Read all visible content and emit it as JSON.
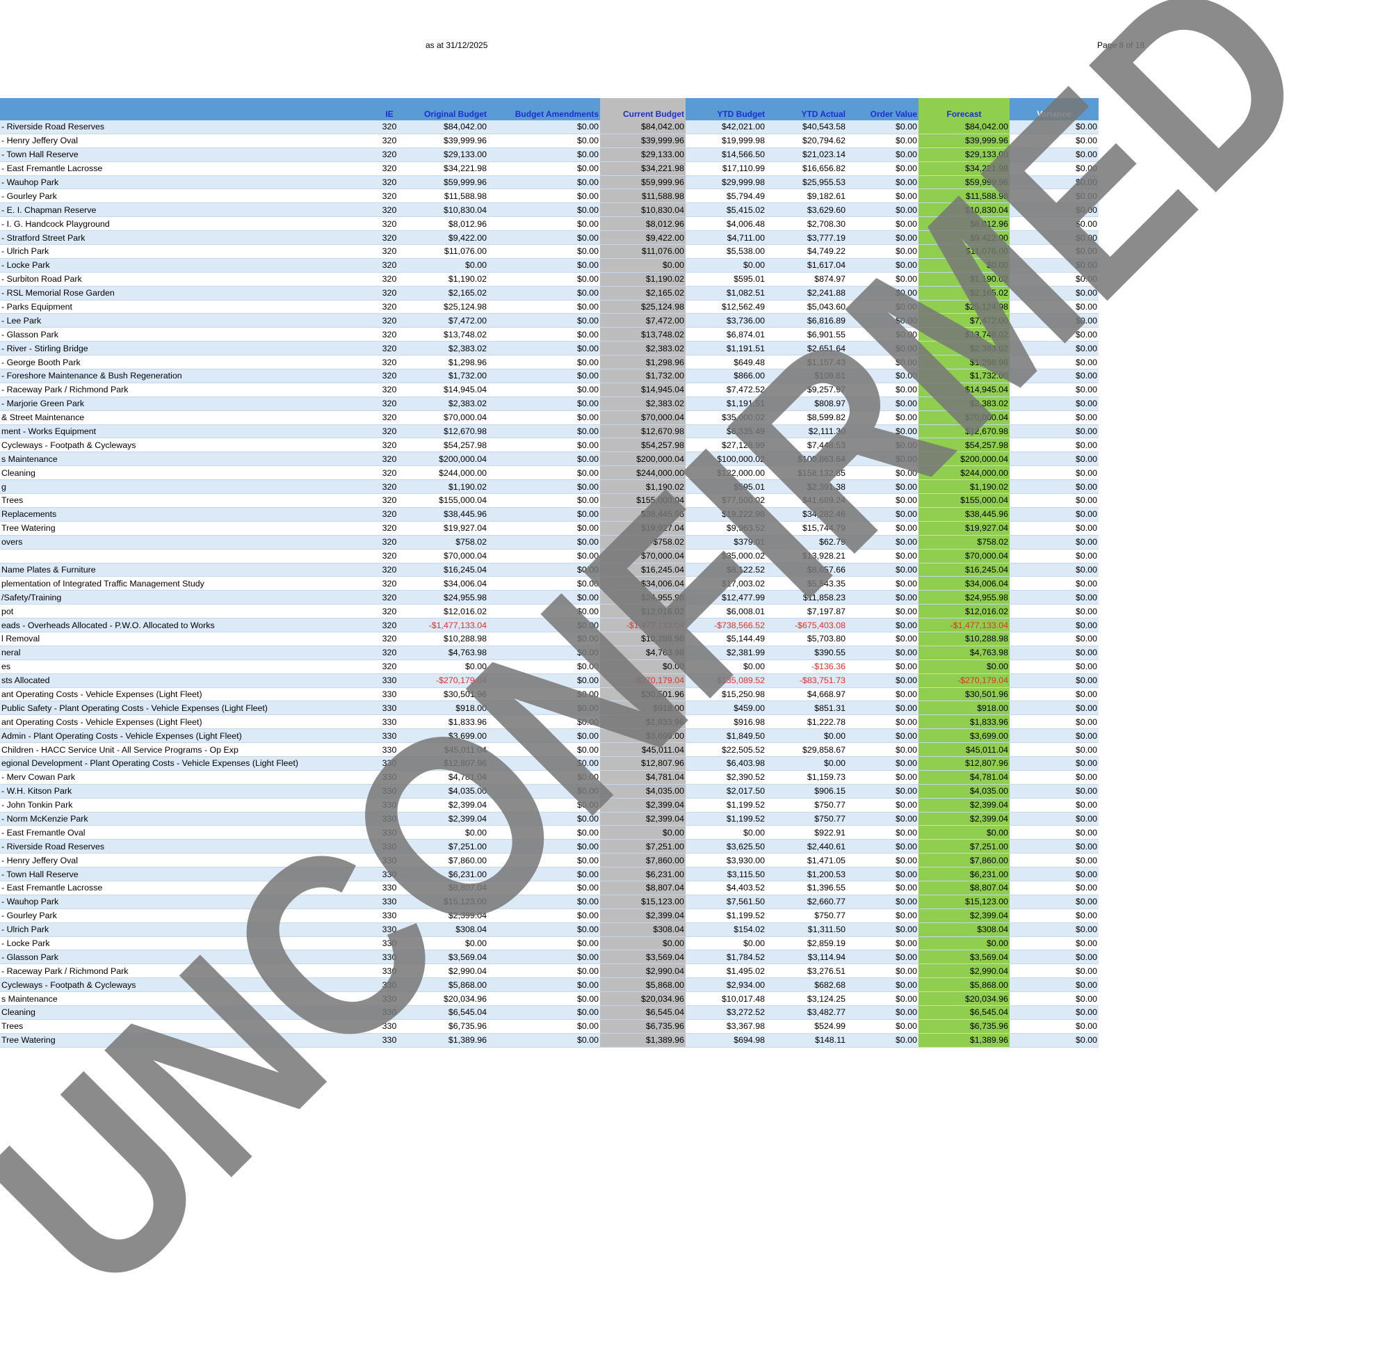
{
  "header": {
    "date_text": "as at 31/12/2025",
    "page_text": "Page 8 of 18"
  },
  "columns": [
    "",
    "IE",
    "Original Budget",
    "Budget Amendments",
    "Current Budget",
    "YTD Budget",
    "YTD Actual",
    "Order Value",
    "Forecast",
    "Variance"
  ],
  "rows": [
    [
      "- Riverside Road Reserves",
      "320",
      "$84,042.00",
      "$0.00",
      "$84,042.00",
      "$42,021.00",
      "$40,543.58",
      "$0.00",
      "$84,042.00",
      "$0.00"
    ],
    [
      "- Henry Jeffery Oval",
      "320",
      "$39,999.96",
      "$0.00",
      "$39,999.96",
      "$19,999.98",
      "$20,794.62",
      "$0.00",
      "$39,999.96",
      "$0.00"
    ],
    [
      "- Town Hall Reserve",
      "320",
      "$29,133.00",
      "$0.00",
      "$29,133.00",
      "$14,566.50",
      "$21,023.14",
      "$0.00",
      "$29,133.00",
      "$0.00"
    ],
    [
      "-  East Fremantle Lacrosse",
      "320",
      "$34,221.98",
      "$0.00",
      "$34,221.98",
      "$17,110.99",
      "$16,656.82",
      "$0.00",
      "$34,221.98",
      "$0.00"
    ],
    [
      "- Wauhop Park",
      "320",
      "$59,999.96",
      "$0.00",
      "$59,999.96",
      "$29,999.98",
      "$25,955.53",
      "$0.00",
      "$59,999.96",
      "$0.00"
    ],
    [
      "- Gourley Park",
      "320",
      "$11,588.98",
      "$0.00",
      "$11,588.98",
      "$5,794.49",
      "$9,182.61",
      "$0.00",
      "$11,588.98",
      "$0.00"
    ],
    [
      "- E. I. Chapman Reserve",
      "320",
      "$10,830.04",
      "$0.00",
      "$10,830.04",
      "$5,415.02",
      "$3,629.60",
      "$0.00",
      "$10,830.04",
      "$0.00"
    ],
    [
      "- I. G. Handcock Playground",
      "320",
      "$8,012.96",
      "$0.00",
      "$8,012.96",
      "$4,006.48",
      "$2,708.30",
      "$0.00",
      "$8,012.96",
      "$0.00"
    ],
    [
      "- Stratford Street Park",
      "320",
      "$9,422.00",
      "$0.00",
      "$9,422.00",
      "$4,711.00",
      "$3,777.19",
      "$0.00",
      "$9,422.00",
      "$0.00"
    ],
    [
      "- Ulrich Park",
      "320",
      "$11,076.00",
      "$0.00",
      "$11,076.00",
      "$5,538.00",
      "$4,749.22",
      "$0.00",
      "$11,076.00",
      "$0.00"
    ],
    [
      "- Locke Park",
      "320",
      "$0.00",
      "$0.00",
      "$0.00",
      "$0.00",
      "$1,617.04",
      "$0.00",
      "$0.00",
      "$0.00"
    ],
    [
      "- Surbiton Road Park",
      "320",
      "$1,190.02",
      "$0.00",
      "$1,190.02",
      "$595.01",
      "$874.97",
      "$0.00",
      "$1,190.02",
      "$0.00"
    ],
    [
      "- RSL Memorial Rose Garden",
      "320",
      "$2,165.02",
      "$0.00",
      "$2,165.02",
      "$1,082.51",
      "$2,241.88",
      "$0.00",
      "$2,165.02",
      "$0.00"
    ],
    [
      "- Parks Equipment",
      "320",
      "$25,124.98",
      "$0.00",
      "$25,124.98",
      "$12,562.49",
      "$5,043.60",
      "$0.00",
      "$25,124.98",
      "$0.00"
    ],
    [
      "- Lee Park",
      "320",
      "$7,472.00",
      "$0.00",
      "$7,472.00",
      "$3,736.00",
      "$6,816.89",
      "$0.00",
      "$7,472.00",
      "$0.00"
    ],
    [
      "- Glasson Park",
      "320",
      "$13,748.02",
      "$0.00",
      "$13,748.02",
      "$6,874.01",
      "$6,901.55",
      "$0.00",
      "$13,748.02",
      "$0.00"
    ],
    [
      "- River - Stirling Bridge",
      "320",
      "$2,383.02",
      "$0.00",
      "$2,383.02",
      "$1,191.51",
      "$2,651.64",
      "$0.00",
      "$2,383.02",
      "$0.00"
    ],
    [
      "- George Booth Park",
      "320",
      "$1,298.96",
      "$0.00",
      "$1,298.96",
      "$649.48",
      "$1,157.43",
      "$0.00",
      "$1,298.96",
      "$0.00"
    ],
    [
      "- Foreshore Maintenance & Bush Regeneration",
      "320",
      "$1,732.00",
      "$0.00",
      "$1,732.00",
      "$866.00",
      "$109.61",
      "$0.00",
      "$1,732.00",
      "$0.00"
    ],
    [
      "- Raceway Park / Richmond Park",
      "320",
      "$14,945.04",
      "$0.00",
      "$14,945.04",
      "$7,472.52",
      "$9,257.97",
      "$0.00",
      "$14,945.04",
      "$0.00"
    ],
    [
      "- Marjorie Green Park",
      "320",
      "$2,383.02",
      "$0.00",
      "$2,383.02",
      "$1,191.51",
      "$808.97",
      "$0.00",
      "$2,383.02",
      "$0.00"
    ],
    [
      "& Street Maintenance",
      "320",
      "$70,000.04",
      "$0.00",
      "$70,000.04",
      "$35,000.02",
      "$8,599.82",
      "$0.00",
      "$70,000.04",
      "$0.00"
    ],
    [
      "ment - Works Equipment",
      "320",
      "$12,670.98",
      "$0.00",
      "$12,670.98",
      "$6,335.49",
      "$2,111.30",
      "$0.00",
      "$12,670.98",
      "$0.00"
    ],
    [
      "Cycleways - Footpath & Cycleways",
      "320",
      "$54,257.98",
      "$0.00",
      "$54,257.98",
      "$27,128.99",
      "$7,448.53",
      "$0.00",
      "$54,257.98",
      "$0.00"
    ],
    [
      "s Maintenance",
      "320",
      "$200,000.04",
      "$0.00",
      "$200,000.04",
      "$100,000.02",
      "$100,863.64",
      "$0.00",
      "$200,000.04",
      "$0.00"
    ],
    [
      " Cleaning",
      "320",
      "$244,000.00",
      "$0.00",
      "$244,000.00",
      "$122,000.00",
      "$158,132.85",
      "$0.00",
      "$244,000.00",
      "$0.00"
    ],
    [
      "g",
      "320",
      "$1,190.02",
      "$0.00",
      "$1,190.02",
      "$595.01",
      "$2,391.38",
      "$0.00",
      "$1,190.02",
      "$0.00"
    ],
    [
      " Trees",
      "320",
      "$155,000.04",
      "$0.00",
      "$155,000.04",
      "$77,500.02",
      "$41,689.24",
      "$0.00",
      "$155,000.04",
      "$0.00"
    ],
    [
      "Replacements",
      "320",
      "$38,445.96",
      "$0.00",
      "$38,445.96",
      "$19,222.98",
      "$34,282.46",
      "$0.00",
      "$38,445.96",
      "$0.00"
    ],
    [
      " Tree Watering",
      "320",
      "$19,927.04",
      "$0.00",
      "$19,927.04",
      "$9,963.52",
      "$15,744.79",
      "$0.00",
      "$19,927.04",
      "$0.00"
    ],
    [
      "overs",
      "320",
      "$758.02",
      "$0.00",
      "$758.02",
      "$379.01",
      "$62.79",
      "$0.00",
      "$758.02",
      "$0.00"
    ],
    [
      "",
      "320",
      "$70,000.04",
      "$0.00",
      "$70,000.04",
      "$35,000.02",
      "$13,928.21",
      "$0.00",
      "$70,000.04",
      "$0.00"
    ],
    [
      " Name Plates & Furniture",
      "320",
      "$16,245.04",
      "$0.00",
      "$16,245.04",
      "$8,122.52",
      "$8,657.66",
      "$0.00",
      "$16,245.04",
      "$0.00"
    ],
    [
      "plementation of Integrated Traffic Management Study",
      "320",
      "$34,006.04",
      "$0.00",
      "$34,006.04",
      "$17,003.02",
      "$5,543.35",
      "$0.00",
      "$34,006.04",
      "$0.00"
    ],
    [
      "/Safety/Training",
      "320",
      "$24,955.98",
      "$0.00",
      "$24,955.98",
      "$12,477.99",
      "$11,858.23",
      "$0.00",
      "$24,955.98",
      "$0.00"
    ],
    [
      "pot",
      "320",
      "$12,016.02",
      "$0.00",
      "$12,016.02",
      "$6,008.01",
      "$7,197.87",
      "$0.00",
      "$12,016.02",
      "$0.00"
    ],
    [
      "eads - Overheads Allocated - P.W.O. Allocated to Works",
      "320",
      "-$1,477,133.04",
      "$0.00",
      "-$1,477,133.04",
      "-$738,566.52",
      "-$675,403.08",
      "$0.00",
      "-$1,477,133.04",
      "$0.00"
    ],
    [
      "l Removal",
      "320",
      "$10,288.98",
      "$0.00",
      "$10,288.98",
      "$5,144.49",
      "$5,703.80",
      "$0.00",
      "$10,288.98",
      "$0.00"
    ],
    [
      "neral",
      "320",
      "$4,763.98",
      "$0.00",
      "$4,763.98",
      "$2,381.99",
      "$390.55",
      "$0.00",
      "$4,763.98",
      "$0.00"
    ],
    [
      "es",
      "320",
      "$0.00",
      "$0.00",
      "$0.00",
      "$0.00",
      "-$136.36",
      "$0.00",
      "$0.00",
      "$0.00"
    ],
    [
      "sts Allocated",
      "330",
      "-$270,179.04",
      "$0.00",
      "-$270,179.04",
      "-$135,089.52",
      "-$83,751.73",
      "$0.00",
      "-$270,179.04",
      "$0.00"
    ],
    [
      "ant Operating Costs - Vehicle Expenses (Light Fleet)",
      "330",
      "$30,501.96",
      "$0.00",
      "$30,501.96",
      "$15,250.98",
      "$4,668.97",
      "$0.00",
      "$30,501.96",
      "$0.00"
    ],
    [
      " Public Safety - Plant Operating Costs - Vehicle Expenses (Light Fleet)",
      "330",
      "$918.00",
      "$0.00",
      "$918.00",
      "$459.00",
      "$851.31",
      "$0.00",
      "$918.00",
      "$0.00"
    ],
    [
      "ant Operating Costs - Vehicle Expenses (Light Fleet)",
      "330",
      "$1,833.96",
      "$0.00",
      "$1,833.96",
      "$916.98",
      "$1,222.78",
      "$0.00",
      "$1,833.96",
      "$0.00"
    ],
    [
      " Admin - Plant Operating Costs - Vehicle Expenses (Light Fleet)",
      "330",
      "$3,699.00",
      "$0.00",
      "$3,699.00",
      "$1,849.50",
      "$0.00",
      "$0.00",
      "$3,699.00",
      "$0.00"
    ],
    [
      "Children - HACC Service Unit - All Service Programs - Op Exp",
      "330",
      "$45,011.04",
      "$0.00",
      "$45,011.04",
      "$22,505.52",
      "$29,858.67",
      "$0.00",
      "$45,011.04",
      "$0.00"
    ],
    [
      "egional Development - Plant Operating Costs - Vehicle Expenses (Light Fleet)",
      "330",
      "$12,807.96",
      "$0.00",
      "$12,807.96",
      "$6,403.98",
      "$0.00",
      "$0.00",
      "$12,807.96",
      "$0.00"
    ],
    [
      "- Merv Cowan Park",
      "330",
      "$4,781.04",
      "$0.00",
      "$4,781.04",
      "$2,390.52",
      "$1,159.73",
      "$0.00",
      "$4,781.04",
      "$0.00"
    ],
    [
      "- W.H. Kitson Park",
      "330",
      "$4,035.00",
      "$0.00",
      "$4,035.00",
      "$2,017.50",
      "$906.15",
      "$0.00",
      "$4,035.00",
      "$0.00"
    ],
    [
      "- John Tonkin Park",
      "330",
      "$2,399.04",
      "$0.00",
      "$2,399.04",
      "$1,199.52",
      "$750.77",
      "$0.00",
      "$2,399.04",
      "$0.00"
    ],
    [
      "- Norm McKenzie Park",
      "330",
      "$2,399.04",
      "$0.00",
      "$2,399.04",
      "$1,199.52",
      "$750.77",
      "$0.00",
      "$2,399.04",
      "$0.00"
    ],
    [
      "- East Fremantle Oval",
      "330",
      "$0.00",
      "$0.00",
      "$0.00",
      "$0.00",
      "$922.91",
      "$0.00",
      "$0.00",
      "$0.00"
    ],
    [
      "- Riverside Road Reserves",
      "330",
      "$7,251.00",
      "$0.00",
      "$7,251.00",
      "$3,625.50",
      "$2,440.61",
      "$0.00",
      "$7,251.00",
      "$0.00"
    ],
    [
      "- Henry Jeffery Oval",
      "330",
      "$7,860.00",
      "$0.00",
      "$7,860.00",
      "$3,930.00",
      "$1,471.05",
      "$0.00",
      "$7,860.00",
      "$0.00"
    ],
    [
      "- Town Hall Reserve",
      "330",
      "$6,231.00",
      "$0.00",
      "$6,231.00",
      "$3,115.50",
      "$1,200.53",
      "$0.00",
      "$6,231.00",
      "$0.00"
    ],
    [
      "-  East Fremantle Lacrosse",
      "330",
      "$8,807.04",
      "$0.00",
      "$8,807.04",
      "$4,403.52",
      "$1,396.55",
      "$0.00",
      "$8,807.04",
      "$0.00"
    ],
    [
      "- Wauhop Park",
      "330",
      "$15,123.00",
      "$0.00",
      "$15,123.00",
      "$7,561.50",
      "$2,660.77",
      "$0.00",
      "$15,123.00",
      "$0.00"
    ],
    [
      "- Gourley Park",
      "330",
      "$2,399.04",
      "$0.00",
      "$2,399.04",
      "$1,199.52",
      "$750.77",
      "$0.00",
      "$2,399.04",
      "$0.00"
    ],
    [
      "- Ulrich Park",
      "330",
      "$308.04",
      "$0.00",
      "$308.04",
      "$154.02",
      "$1,311.50",
      "$0.00",
      "$308.04",
      "$0.00"
    ],
    [
      "- Locke Park",
      "330",
      "$0.00",
      "$0.00",
      "$0.00",
      "$0.00",
      "$2,859.19",
      "$0.00",
      "$0.00",
      "$0.00"
    ],
    [
      "- Glasson Park",
      "330",
      "$3,569.04",
      "$0.00",
      "$3,569.04",
      "$1,784.52",
      "$3,114.94",
      "$0.00",
      "$3,569.04",
      "$0.00"
    ],
    [
      "- Raceway Park / Richmond Park",
      "330",
      "$2,990.04",
      "$0.00",
      "$2,990.04",
      "$1,495.02",
      "$3,276.51",
      "$0.00",
      "$2,990.04",
      "$0.00"
    ],
    [
      "Cycleways - Footpath & Cycleways",
      "330",
      "$5,868.00",
      "$0.00",
      "$5,868.00",
      "$2,934.00",
      "$682.68",
      "$0.00",
      "$5,868.00",
      "$0.00"
    ],
    [
      "s Maintenance",
      "330",
      "$20,034.96",
      "$0.00",
      "$20,034.96",
      "$10,017.48",
      "$3,124.25",
      "$0.00",
      "$20,034.96",
      "$0.00"
    ],
    [
      " Cleaning",
      "330",
      "$6,545.04",
      "$0.00",
      "$6,545.04",
      "$3,272.52",
      "$3,482.77",
      "$0.00",
      "$6,545.04",
      "$0.00"
    ],
    [
      " Trees",
      "330",
      "$6,735.96",
      "$0.00",
      "$6,735.96",
      "$3,367.98",
      "$524.99",
      "$0.00",
      "$6,735.96",
      "$0.00"
    ],
    [
      " Tree Watering",
      "330",
      "$1,389.96",
      "$0.00",
      "$1,389.96",
      "$694.98",
      "$148.11",
      "$0.00",
      "$1,389.96",
      "$0.00"
    ]
  ],
  "watermark": {
    "text": "UNCONFIRMED",
    "color": "#777777"
  },
  "colors": {
    "header_blue": "#5b9bd5",
    "forecast_green": "#8fce4e",
    "current_gray": "#bdbdbd",
    "stripe_blue": "#dce9f6",
    "negative_red": "#e0312b"
  }
}
